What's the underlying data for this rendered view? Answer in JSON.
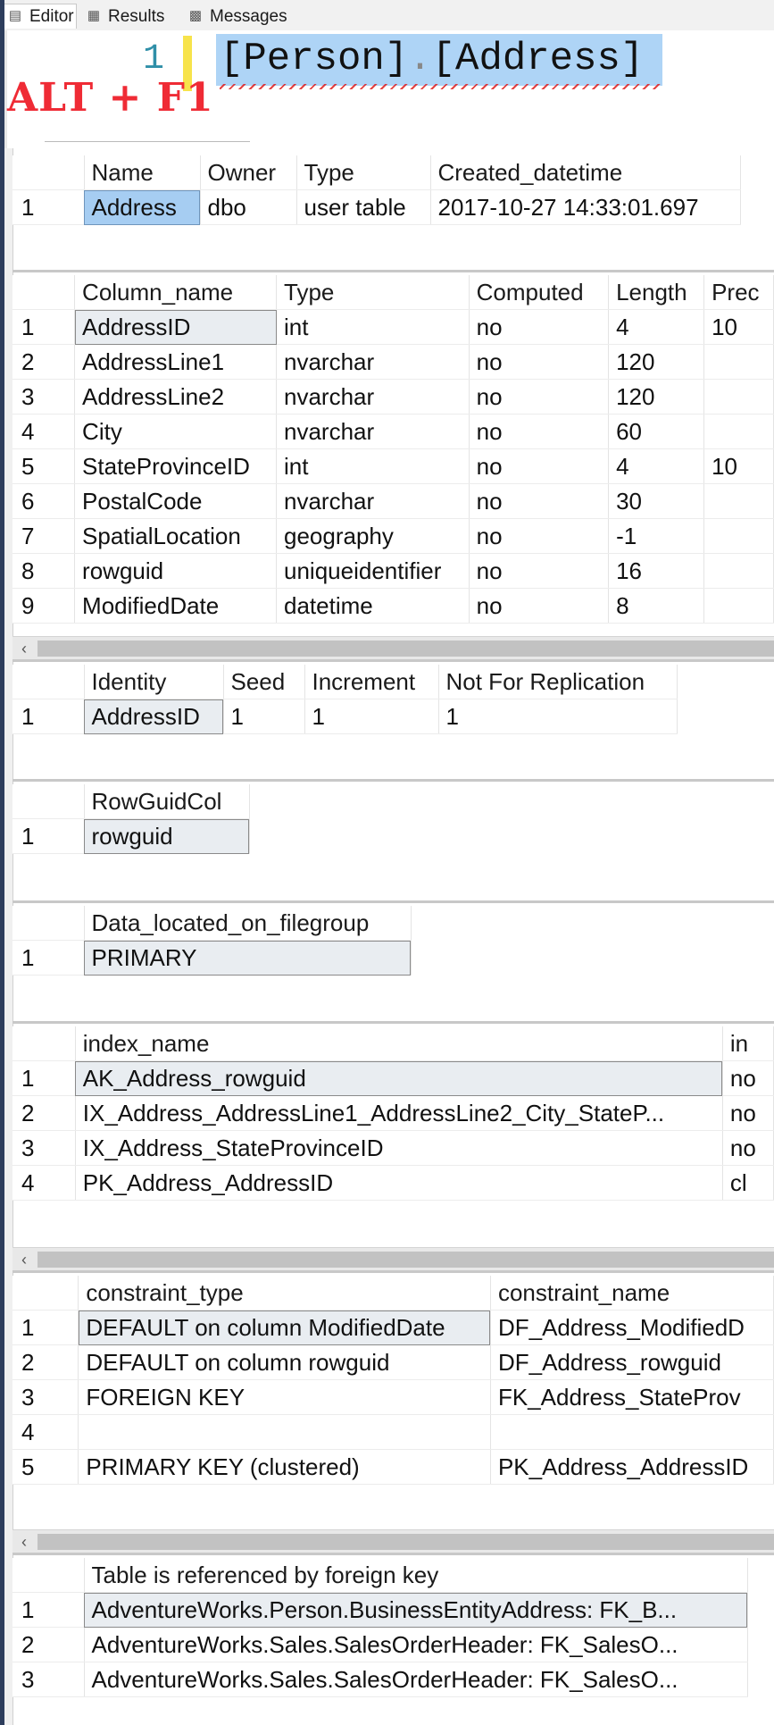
{
  "tabs": [
    {
      "label": "Editor",
      "icon": "editor-icon",
      "active": true
    },
    {
      "label": "Results",
      "icon": "grid-icon",
      "active": false
    },
    {
      "label": "Messages",
      "icon": "messages-icon",
      "active": false
    }
  ],
  "editor": {
    "line_number": "1",
    "code_part1": "[Person]",
    "code_dot": ".",
    "code_part2": "[Address]",
    "overlay_text": "ALT + F1"
  },
  "grids": [
    {
      "columns": [
        "Name",
        "Owner",
        "Type",
        "Created_datetime"
      ],
      "widths": [
        130,
        108,
        150,
        347
      ],
      "rows": [
        [
          "1",
          "Address",
          "dbo",
          "user table",
          "2017-10-27 14:33:01.697"
        ]
      ]
    },
    {
      "columns": [
        "Column_name",
        "Type",
        "Computed",
        "Length",
        "Prec"
      ],
      "widths": [
        232,
        222,
        162,
        110,
        80
      ],
      "rows": [
        [
          "1",
          "AddressID",
          "int",
          "no",
          "4",
          "10"
        ],
        [
          "2",
          "AddressLine1",
          "nvarchar",
          "no",
          "120",
          ""
        ],
        [
          "3",
          "AddressLine2",
          "nvarchar",
          "no",
          "120",
          ""
        ],
        [
          "4",
          "City",
          "nvarchar",
          "no",
          "60",
          ""
        ],
        [
          "5",
          "StateProvinceID",
          "int",
          "no",
          "4",
          "10"
        ],
        [
          "6",
          "PostalCode",
          "nvarchar",
          "no",
          "30",
          ""
        ],
        [
          "7",
          "SpatialLocation",
          "geography",
          "no",
          "-1",
          ""
        ],
        [
          "8",
          "rowguid",
          "uniqueidentifier",
          "no",
          "16",
          ""
        ],
        [
          "9",
          "ModifiedDate",
          "datetime",
          "no",
          "8",
          ""
        ]
      ]
    },
    {
      "columns": [
        "Identity",
        "Seed",
        "Increment",
        "Not For Replication"
      ],
      "widths": [
        156,
        91,
        150,
        267
      ],
      "rows": [
        [
          "1",
          "AddressID",
          "1",
          "1",
          "1"
        ]
      ]
    },
    {
      "columns": [
        "RowGuidCol"
      ],
      "widths": [
        185
      ],
      "rows": [
        [
          "1",
          "rowguid"
        ]
      ]
    },
    {
      "columns": [
        "Data_located_on_filegroup"
      ],
      "widths": [
        366
      ],
      "rows": [
        [
          "1",
          "PRIMARY"
        ]
      ]
    },
    {
      "columns": [
        "index_name",
        "in"
      ],
      "widths": [
        740,
        60
      ],
      "rows": [
        [
          "1",
          "AK_Address_rowguid",
          "no"
        ],
        [
          "2",
          "IX_Address_AddressLine1_AddressLine2_City_StateP...",
          "no"
        ],
        [
          "3",
          "IX_Address_StateProvinceID",
          "no"
        ],
        [
          "4",
          "PK_Address_AddressID",
          "cl"
        ]
      ]
    },
    {
      "columns": [
        "constraint_type",
        "constraint_name"
      ],
      "widths": [
        468,
        320
      ],
      "rows": [
        [
          "1",
          "DEFAULT on column ModifiedDate",
          "DF_Address_ModifiedD"
        ],
        [
          "2",
          "DEFAULT on column rowguid",
          "DF_Address_rowguid"
        ],
        [
          "3",
          "FOREIGN KEY",
          "FK_Address_StateProv"
        ],
        [
          "4",
          "",
          ""
        ],
        [
          "5",
          "PRIMARY KEY (clustered)",
          "PK_Address_AddressID"
        ]
      ]
    },
    {
      "columns": [
        "Table is referenced by foreign key"
      ],
      "widths": [
        743
      ],
      "rows": [
        [
          "1",
          "AdventureWorks.Person.BusinessEntityAddress: FK_B..."
        ],
        [
          "2",
          "AdventureWorks.Sales.SalesOrderHeader: FK_SalesO..."
        ],
        [
          "3",
          "AdventureWorks.Sales.SalesOrderHeader: FK_SalesO..."
        ]
      ]
    }
  ]
}
